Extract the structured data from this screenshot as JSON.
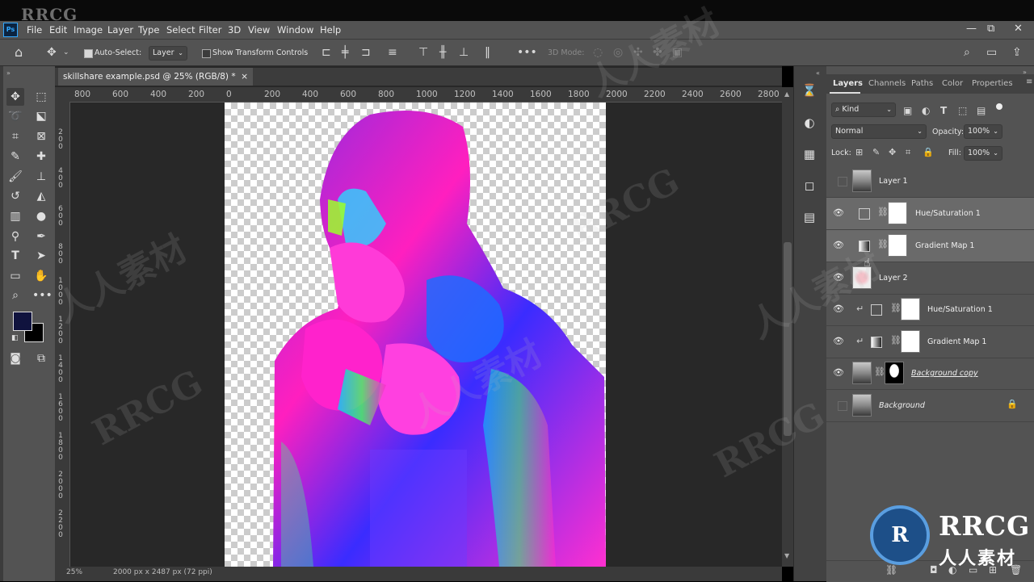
{
  "watermark": {
    "top_left": "RRCG",
    "repeated": "RRCG",
    "cn": "人人素材",
    "logo_text": "RRCG",
    "logo_sub": "人人素材"
  },
  "app": {
    "logo": "Ps"
  },
  "menu": [
    "File",
    "Edit",
    "Image",
    "Layer",
    "Type",
    "Select",
    "Filter",
    "3D",
    "View",
    "Window",
    "Help"
  ],
  "window_controls": {
    "minimize": "—",
    "restore": "⧉",
    "close": "✕"
  },
  "options": {
    "auto_select_label": "Auto-Select:",
    "auto_select_checked": true,
    "auto_select_target": "Layer",
    "transform_controls_label": "Show Transform Controls",
    "transform_controls_checked": false,
    "mode_3d_label": "3D Mode:"
  },
  "document": {
    "tab_title": "skillshare example.psd @ 25% (RGB/8) *",
    "tab_close": "×"
  },
  "ruler_h": [
    "800",
    "600",
    "400",
    "200",
    "0",
    "200",
    "400",
    "600",
    "800",
    "1000",
    "1200",
    "1400",
    "1600",
    "1800",
    "2000",
    "2200",
    "2400",
    "2600",
    "2800"
  ],
  "ruler_v": [
    "2 0 0",
    "4 0 0",
    "6 0 0",
    "8 0 0",
    "1 0 0 0",
    "1 2 0 0",
    "1 4 0 0",
    "1 6 0 0",
    "1 8 0 0",
    "2 0 0 0",
    "2 2 0 0"
  ],
  "status": {
    "zoom": "25%",
    "info": "2000 px x 2487 px (72 ppi)"
  },
  "colors": {
    "foreground": "#10133e",
    "background": "#000000",
    "accent_blue": "#31a8ff"
  },
  "panel": {
    "tabs": [
      "Layers",
      "Channels",
      "Paths",
      "Color",
      "Properties"
    ],
    "active_tab": "Layers",
    "filter_kind": "Kind",
    "blend_mode": "Normal",
    "opacity_label": "Opacity:",
    "opacity_value": "100%",
    "lock_label": "Lock:",
    "fill_label": "Fill:",
    "fill_value": "100%"
  },
  "layers": [
    {
      "name": "Layer 1",
      "visible": false,
      "type": "photo",
      "selected": false
    },
    {
      "name": "Hue/Saturation 1",
      "visible": true,
      "type": "adjustment",
      "selected": true
    },
    {
      "name": "Gradient Map 1",
      "visible": true,
      "type": "adjustment",
      "selected": true
    },
    {
      "name": "Layer 2",
      "visible": true,
      "type": "flowers",
      "selected": false
    },
    {
      "name": "Hue/Saturation 1",
      "visible": true,
      "type": "adjustment-clipped",
      "selected": false
    },
    {
      "name": "Gradient Map 1",
      "visible": true,
      "type": "adjustment-clipped",
      "selected": false
    },
    {
      "name": "Background copy",
      "visible": true,
      "type": "masked",
      "selected": false
    },
    {
      "name": "Background",
      "visible": false,
      "type": "background",
      "selected": false,
      "locked": true
    }
  ],
  "tool_icons": [
    "move-tool",
    "marquee-tool",
    "lasso-tool",
    "object-select-tool",
    "crop-tool",
    "frame-tool",
    "eyedropper-tool",
    "healing-brush-tool",
    "brush-tool",
    "clone-stamp-tool",
    "history-brush-tool",
    "eraser-tool",
    "gradient-tool",
    "blur-tool",
    "dodge-tool",
    "pen-tool",
    "type-tool",
    "path-select-tool",
    "rectangle-tool",
    "hand-tool",
    "zoom-tool",
    "more-tools"
  ]
}
